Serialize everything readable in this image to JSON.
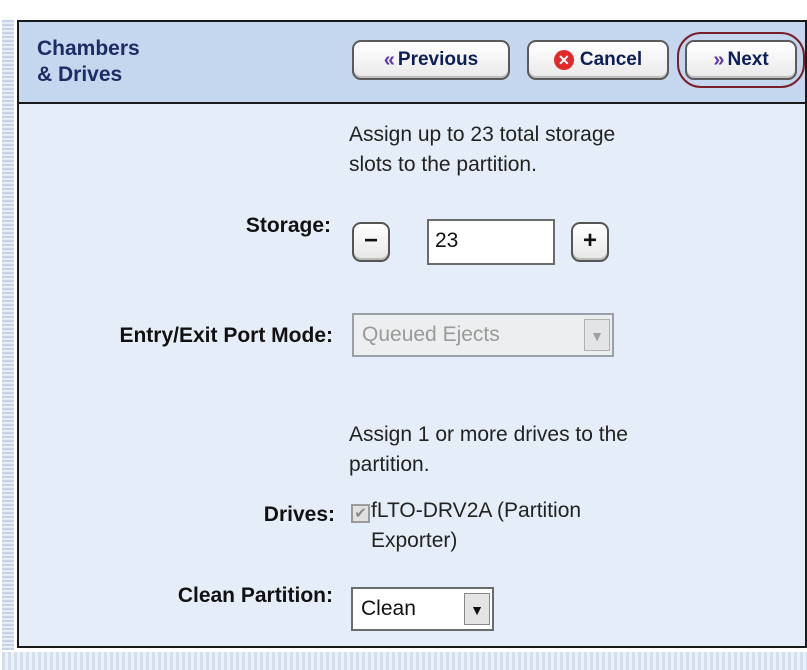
{
  "header": {
    "title_line1": "Chambers",
    "title_line2": "& Drives",
    "buttons": {
      "previous_label": "Previous",
      "cancel_label": "Cancel",
      "next_label": "Next"
    }
  },
  "storage": {
    "instruction_line1": "Assign up to 23 total storage",
    "instruction_line2": "slots to the partition.",
    "label": "Storage:",
    "decrement_label": "−",
    "increment_label": "+",
    "value": "23"
  },
  "ee_port": {
    "label": "Entry/Exit Port Mode:",
    "selected": "Queued Ejects",
    "disabled": true
  },
  "drives": {
    "instruction_line1": "Assign 1 or more drives to the",
    "instruction_line2": "partition.",
    "label": "Drives:",
    "item_line1": "fLTO-DRV2A (Partition",
    "item_line2": "Exporter)",
    "checked": true
  },
  "clean_partition": {
    "label": "Clean Partition:",
    "selected": "Clean"
  },
  "colors": {
    "panel_bg": "#e5eef8",
    "header_bg": "#c5d7ee",
    "title_color": "#1b2d63",
    "next_ring": "#7a1f2a",
    "cancel_icon": "#e02a2a"
  }
}
